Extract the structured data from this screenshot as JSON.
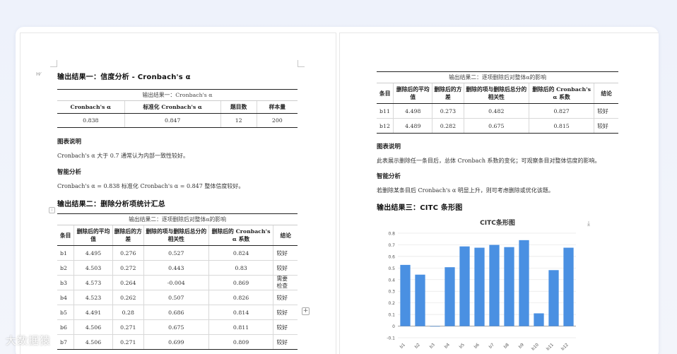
{
  "left": {
    "section1": {
      "title": "输出结果一：信度分析 - Cronbach's α",
      "table_caption": "输出结果一：Cronbach's α",
      "headers": [
        "Cronbach's α",
        "标准化 Cronbach's α",
        "题目数",
        "样本量"
      ],
      "row": [
        "0.838",
        "0.847",
        "12",
        "200"
      ],
      "legend_heading": "图表说明",
      "legend_text": "Cronbach's α 大于 0.7 通常认为内部一致性较好。",
      "smart_heading": "智能分析",
      "smart_text": "Cronbach's α = 0.838 标准化 Cronbach's α = 0.847 整体信度较好。"
    },
    "section2": {
      "title": "输出结果二：删除分析项统计汇总",
      "table_caption": "输出结果二：逐项删除后对整体α的影响",
      "headers": [
        "条目",
        "删除后的平均值",
        "删除后的方差",
        "删除的项与删除后总分的相关性",
        "删除后的 Cronbach's α 系数",
        "结论"
      ],
      "rows": [
        [
          "b1",
          "4.495",
          "0.276",
          "0.527",
          "0.824",
          "较好"
        ],
        [
          "b2",
          "4.503",
          "0.272",
          "0.443",
          "0.83",
          "较好"
        ],
        [
          "b3",
          "4.573",
          "0.264",
          "-0.004",
          "0.869",
          "需要检查"
        ],
        [
          "b4",
          "4.523",
          "0.262",
          "0.507",
          "0.826",
          "较好"
        ],
        [
          "b5",
          "4.491",
          "0.28",
          "0.686",
          "0.814",
          "较好"
        ],
        [
          "b6",
          "4.506",
          "0.271",
          "0.675",
          "0.811",
          "较好"
        ],
        [
          "b7",
          "4.506",
          "0.271",
          "0.699",
          "0.809",
          "较好"
        ]
      ]
    },
    "handle_label": "H⁄",
    "add_label": "+"
  },
  "right": {
    "table_caption": "输出结果二：逐项删除后对整体α的影响",
    "headers": [
      "条目",
      "删除后的平均值",
      "删除后的方差",
      "删除的项与删除后总分的相关性",
      "删除后的 Cronbach's α 系数",
      "结论"
    ],
    "rows": [
      [
        "b11",
        "4.498",
        "0.273",
        "0.482",
        "0.827",
        "较好"
      ],
      [
        "b12",
        "4.489",
        "0.282",
        "0.675",
        "0.815",
        "较好"
      ]
    ],
    "legend_heading": "图表说明",
    "legend_text": "此表展示删除任一条目后，总体 Cronbach 系数的变化；可观察条目对整体信度的影响。",
    "smart_heading": "智能分析",
    "smart_text": "若删除某条目后 Cronbach's α 明显上升，则可考虑删除或优化该题。",
    "section3_title": "输出结果三：CITC 条形图",
    "download_icon": "⤓"
  },
  "logo_text": "大数据猿",
  "colors": {
    "bar": "#4a90e2",
    "accent_underline": "#dd3333"
  },
  "chart_data": {
    "type": "bar",
    "title": "CITC条形图",
    "categories": [
      "b1",
      "b2",
      "b3",
      "b4",
      "b5",
      "b6",
      "b7",
      "b8",
      "b9",
      "b10",
      "b11",
      "b12"
    ],
    "values": [
      0.527,
      0.443,
      -0.004,
      0.507,
      0.686,
      0.675,
      0.699,
      0.68,
      0.74,
      0.11,
      0.482,
      0.675
    ],
    "ylim": [
      -0.1,
      0.8
    ],
    "yticks": [
      "0.8",
      "0.7",
      "0.6",
      "0.5",
      "0.4",
      "0.3",
      "0.2",
      "0.1",
      "0",
      "-0.1"
    ],
    "grid": true
  }
}
